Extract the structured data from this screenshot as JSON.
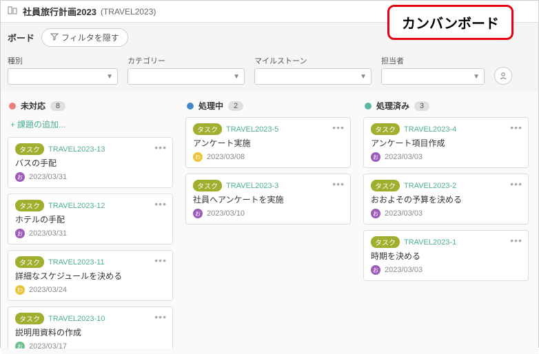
{
  "header": {
    "title": "社員旅行計画2023",
    "code": "(TRAVEL2023)"
  },
  "callout": "カンバンボード",
  "toolbar": {
    "board_label": "ボード",
    "filter_btn": "フィルタを隠す"
  },
  "filters": {
    "type": "種別",
    "category": "カテゴリー",
    "milestone": "マイルストーン",
    "assignee": "担当者"
  },
  "columns": [
    {
      "name": "未対応",
      "dot": "dot-red",
      "count": "8",
      "add_label": "課題の追加...",
      "cards": [
        {
          "badge": "タスク",
          "id": "TRAVEL2023-13",
          "title": "バスの手配",
          "avatar": "av-purple",
          "avatar_text": "お",
          "date": "2023/03/31"
        },
        {
          "badge": "タスク",
          "id": "TRAVEL2023-12",
          "title": "ホテルの手配",
          "avatar": "av-purple",
          "avatar_text": "お",
          "date": "2023/03/31"
        },
        {
          "badge": "タスク",
          "id": "TRAVEL2023-11",
          "title": "詳細なスケジュールを決める",
          "avatar": "av-yellow",
          "avatar_text": "わ",
          "date": "2023/03/24"
        },
        {
          "badge": "タスク",
          "id": "TRAVEL2023-10",
          "title": "説明用資料の作成",
          "avatar": "av-green",
          "avatar_text": "お",
          "date": "2023/03/17"
        }
      ]
    },
    {
      "name": "処理中",
      "dot": "dot-blue",
      "count": "2",
      "cards": [
        {
          "badge": "タスク",
          "id": "TRAVEL2023-5",
          "title": "アンケート実施",
          "avatar": "av-yellow",
          "avatar_text": "わ",
          "date": "2023/03/08"
        },
        {
          "badge": "タスク",
          "id": "TRAVEL2023-3",
          "title": "社員へアンケートを実施",
          "avatar": "av-purple",
          "avatar_text": "お",
          "date": "2023/03/10"
        }
      ]
    },
    {
      "name": "処理済み",
      "dot": "dot-green",
      "count": "3",
      "cards": [
        {
          "badge": "タスク",
          "id": "TRAVEL2023-4",
          "title": "アンケート項目作成",
          "avatar": "av-purple",
          "avatar_text": "お",
          "date": "2023/03/03"
        },
        {
          "badge": "タスク",
          "id": "TRAVEL2023-2",
          "title": "おおよその予算を決める",
          "avatar": "av-purple",
          "avatar_text": "お",
          "date": "2023/03/03"
        },
        {
          "badge": "タスク",
          "id": "TRAVEL2023-1",
          "title": "時期を決める",
          "avatar": "av-purple",
          "avatar_text": "お",
          "date": "2023/03/03"
        }
      ]
    }
  ]
}
